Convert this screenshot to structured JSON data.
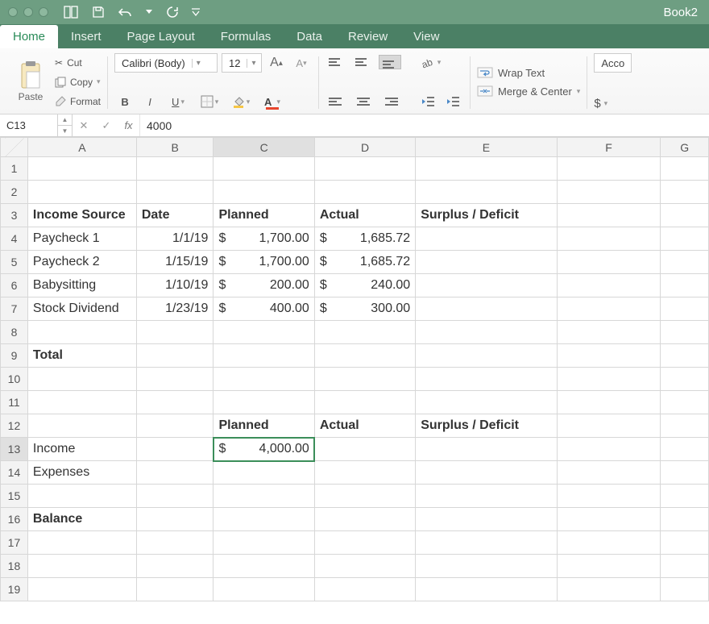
{
  "window": {
    "title": "Book2"
  },
  "tabs": [
    "Home",
    "Insert",
    "Page Layout",
    "Formulas",
    "Data",
    "Review",
    "View"
  ],
  "active_tab": "Home",
  "clipboard": {
    "paste": "Paste",
    "cut": "Cut",
    "copy": "Copy",
    "format": "Format"
  },
  "font": {
    "name": "Calibri (Body)",
    "size": "12",
    "bold": "B",
    "italic": "I",
    "underline": "U"
  },
  "wrap_merge": {
    "wrap": "Wrap Text",
    "merge": "Merge & Center"
  },
  "numfmt": {
    "preset": "Acco",
    "dollar": "$"
  },
  "namebox": {
    "ref": "C13"
  },
  "formula": {
    "fx": "fx",
    "value": "4000"
  },
  "columns": [
    "A",
    "B",
    "C",
    "D",
    "E",
    "F",
    "G"
  ],
  "row_headers": [
    "1",
    "2",
    "3",
    "4",
    "5",
    "6",
    "7",
    "8",
    "9",
    "10",
    "11",
    "12",
    "13",
    "14",
    "15",
    "16",
    "17",
    "18",
    "19"
  ],
  "active": {
    "col_index": 2,
    "row_index": 12
  },
  "cells": {
    "r3": {
      "A": "Income Source",
      "B": "Date",
      "C": "Planned",
      "D": "Actual",
      "E": "Surplus / Deficit"
    },
    "r4": {
      "A": "Paycheck 1",
      "B": "1/1/19",
      "C_cur": "$",
      "C_val": "1,700.00",
      "D_cur": "$",
      "D_val": "1,685.72"
    },
    "r5": {
      "A": "Paycheck 2",
      "B": "1/15/19",
      "C_cur": "$",
      "C_val": "1,700.00",
      "D_cur": "$",
      "D_val": "1,685.72"
    },
    "r6": {
      "A": "Babysitting",
      "B": "1/10/19",
      "C_cur": "$",
      "C_val": "200.00",
      "D_cur": "$",
      "D_val": "240.00"
    },
    "r7": {
      "A": "Stock Dividend",
      "B": "1/23/19",
      "C_cur": "$",
      "C_val": "400.00",
      "D_cur": "$",
      "D_val": "300.00"
    },
    "r9": {
      "A": "Total"
    },
    "r12": {
      "C": "Planned",
      "D": "Actual",
      "E": "Surplus / Deficit"
    },
    "r13": {
      "A": "Income",
      "C_cur": "$",
      "C_val": "4,000.00"
    },
    "r14": {
      "A": "Expenses"
    },
    "r16": {
      "A": "Balance"
    }
  }
}
